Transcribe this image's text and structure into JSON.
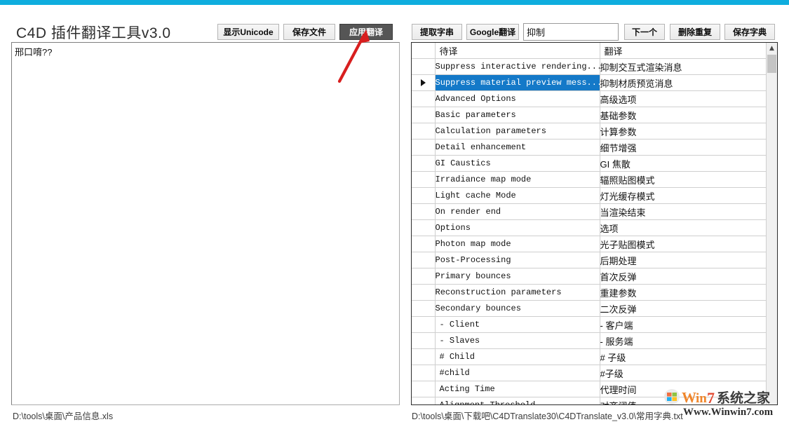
{
  "window": {
    "accent_color": "#0fadde",
    "title": "C4D 插件翻译工具v3.0",
    "controls": {
      "minimize": "−",
      "maximize": "□",
      "close": "✕"
    }
  },
  "toolbar": {
    "show_unicode_label": "显示Unicode",
    "save_file_label": "保存文件",
    "apply_translation_label": "应用翻译",
    "extract_string_label": "提取字串",
    "google_translate_label": "Google翻译",
    "search_value": "抑制",
    "next_label": "下一个",
    "dedupe_label": "删除重复",
    "save_dict_label": "保存字典"
  },
  "left_editor": {
    "content": "邢口唷??"
  },
  "status": {
    "left_path": "D:\\tools\\桌面\\产品信息.xls",
    "right_path": "D:\\tools\\桌面\\下载吧\\C4DTranslate30\\C4DTranslate_v3.0\\常用字典.txt"
  },
  "grid": {
    "headers": {
      "marker": "",
      "source": "待译",
      "target": "翻译"
    },
    "selected_index": 1,
    "rows": [
      {
        "marker": "",
        "source": "Suppress interactive rendering...",
        "target": "抑制交互式渲染消息",
        "indent": true
      },
      {
        "marker": "▶",
        "source": "Suppress material preview mess...",
        "target": "抑制材质预览消息",
        "indent": true
      },
      {
        "marker": "",
        "source": "Advanced Options",
        "target": "高级选项",
        "indent": true
      },
      {
        "marker": "",
        "source": "Basic parameters",
        "target": "基础参数",
        "indent": true
      },
      {
        "marker": "",
        "source": "Calculation parameters",
        "target": "计算参数",
        "indent": true
      },
      {
        "marker": "",
        "source": "Detail enhancement",
        "target": "细节增强",
        "indent": true
      },
      {
        "marker": "",
        "source": "GI Caustics",
        "target": "GI 焦散",
        "indent": true
      },
      {
        "marker": "",
        "source": "Irradiance map mode",
        "target": "辐照贴图模式",
        "indent": true
      },
      {
        "marker": "",
        "source": "Light cache Mode",
        "target": "灯光缓存模式",
        "indent": true
      },
      {
        "marker": "",
        "source": "On render end",
        "target": "当渲染结束",
        "indent": true
      },
      {
        "marker": "",
        "source": "Options",
        "target": "选项",
        "indent": true
      },
      {
        "marker": "",
        "source": "Photon map mode",
        "target": "光子贴图模式",
        "indent": true
      },
      {
        "marker": "",
        "source": "Post-Processing",
        "target": "后期处理",
        "indent": true
      },
      {
        "marker": "",
        "source": "Primary bounces",
        "target": "首次反弹",
        "indent": true
      },
      {
        "marker": "",
        "source": "Reconstruction parameters",
        "target": "重建参数",
        "indent": true
      },
      {
        "marker": "",
        "source": "Secondary bounces",
        "target": "二次反弹",
        "indent": true
      },
      {
        "marker": "",
        "source": "- Client",
        "target": "- 客户端",
        "indent": false
      },
      {
        "marker": "",
        "source": "- Slaves",
        "target": "- 服务端",
        "indent": false
      },
      {
        "marker": "",
        "source": "# Child",
        "target": "# 子级",
        "indent": false
      },
      {
        "marker": "",
        "source": "#child",
        "target": "#子级",
        "indent": false
      },
      {
        "marker": "",
        "source": "Acting Time",
        "target": "代理时间",
        "indent": false
      },
      {
        "marker": "",
        "source": "Alignment Threshold",
        "target": "对齐阈值",
        "indent": false
      }
    ],
    "scrollbar": {
      "up_arrow": "▲"
    }
  },
  "annotation": {
    "arrow_color": "#d81f1f"
  },
  "watermark": {
    "brand": "系统之家",
    "win": "Win",
    "seven": "7",
    "url": "Www.Winwin7.com"
  }
}
